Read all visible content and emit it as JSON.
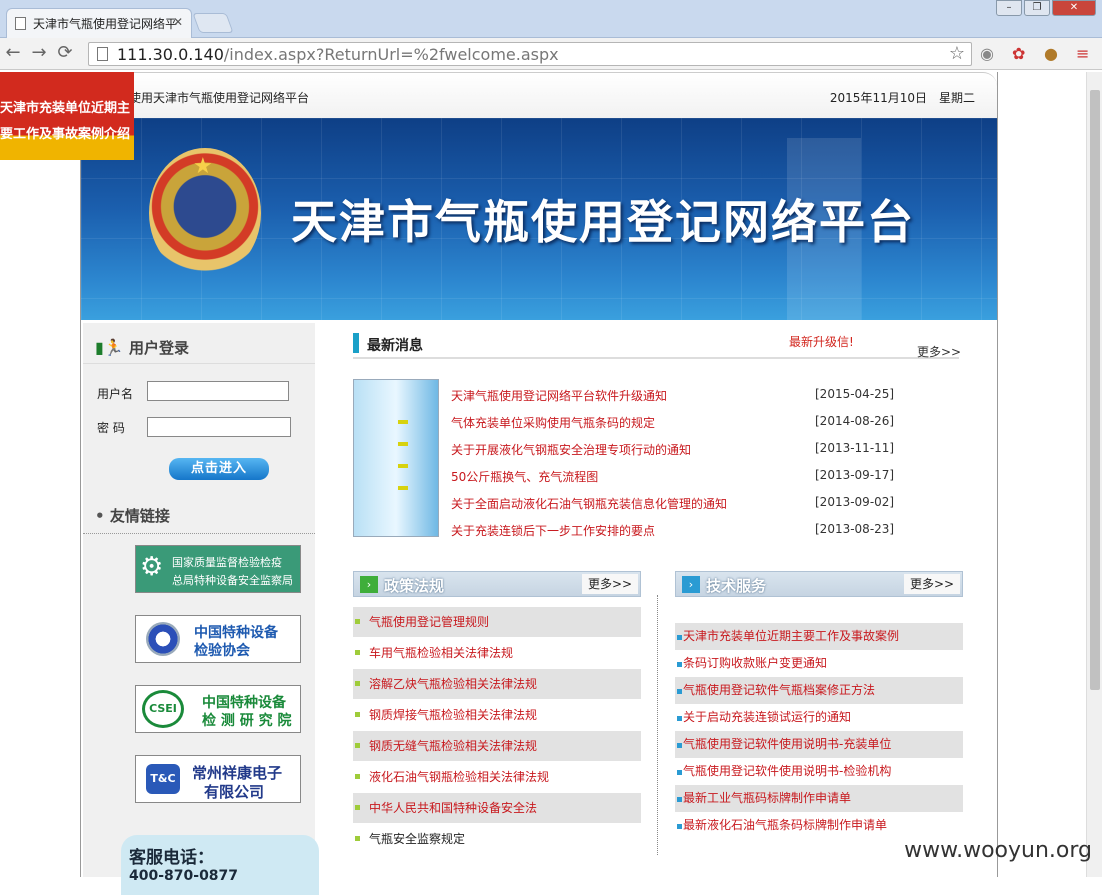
{
  "browser": {
    "tab_title": "天津市气瓶使用登记网络平",
    "url_host": "111.30.0.140",
    "url_path": "/index.aspx?ReturnUrl=%2fwelcome.aspx"
  },
  "header": {
    "welcome": "使用天津市气瓶使用登记网络平台",
    "date": "2015年11月10日　星期二",
    "banner_title": "天津市气瓶使用登记网络平台"
  },
  "float_ad": {
    "line1": "天津市充装单位近期主",
    "line2": "要工作及事故案例介绍"
  },
  "login": {
    "title": "用户登录",
    "username_label": "用户名",
    "password_label": "密 码",
    "submit": "点击进入"
  },
  "links": {
    "title": "友情链接",
    "items": [
      {
        "line1": "国家质量监督检验检疫",
        "line2": "总局特种设备安全监察局"
      },
      {
        "line1": "中国特种设备",
        "line2": "检验协会"
      },
      {
        "line1": "中国特种设备",
        "line2": "检 测 研 究 院",
        "logo": "CSEI"
      },
      {
        "line1": "常州祥康电子",
        "line2": "有限公司",
        "logo": "T&C"
      }
    ]
  },
  "service": {
    "title": "客服电话：",
    "phone": "400-870-0877"
  },
  "news": {
    "title": "最新消息",
    "latest_upgrade": "最新升级信!",
    "more": "更多>>",
    "items": [
      {
        "title": "天津气瓶使用登记网络平台软件升级通知",
        "date": "[2015-04-25]"
      },
      {
        "title": "气体充装单位采购使用气瓶条码的规定",
        "date": "[2014-08-26]"
      },
      {
        "title": "关于开展液化气钢瓶安全治理专项行动的通知",
        "date": "[2013-11-11]"
      },
      {
        "title": "50公斤瓶换气、充气流程图",
        "date": "[2013-09-17]"
      },
      {
        "title": "关于全面启动液化石油气钢瓶充装信息化管理的通知",
        "date": "[2013-09-02]"
      },
      {
        "title": "关于充装连锁后下一步工作安排的要点",
        "date": "[2013-08-23]"
      }
    ]
  },
  "policy": {
    "title": "政策法规",
    "more": "更多>>",
    "items": [
      "气瓶使用登记管理规则",
      "车用气瓶检验相关法律法规",
      "溶解乙炔气瓶检验相关法律法规",
      "钢质焊接气瓶检验相关法律法规",
      "钢质无缝气瓶检验相关法律法规",
      "液化石油气钢瓶检验相关法律法规",
      "中华人民共和国特种设备安全法",
      "气瓶安全监察规定"
    ]
  },
  "tech": {
    "title": "技术服务",
    "more": "更多>>",
    "items": [
      "天津市充装单位近期主要工作及事故案例",
      "条码订购收款账户变更通知",
      "气瓶使用登记软件气瓶档案修正方法",
      "关于启动充装连锁试运行的通知",
      "气瓶使用登记软件使用说明书-充装单位",
      "气瓶使用登记软件使用说明书-检验机构",
      "最新工业气瓶码标牌制作申请单",
      "最新液化石油气瓶条码标牌制作申请单"
    ]
  },
  "watermark": "www.wooyun.org"
}
